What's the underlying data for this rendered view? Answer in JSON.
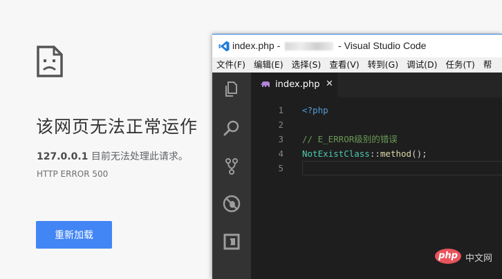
{
  "error_page": {
    "title": "该网页无法正常运作",
    "host": "127.0.0.1",
    "description": " 目前无法处理此请求。",
    "error_code": "HTTP ERROR 500",
    "reload_button": "重新加载"
  },
  "vscode": {
    "title_prefix": "index.php - ",
    "title_suffix": " - Visual Studio Code",
    "menu": [
      "文件(F)",
      "编辑(E)",
      "选择(S)",
      "查看(V)",
      "转到(G)",
      "调试(D)",
      "任务(T)",
      "帮"
    ],
    "activity_icons": [
      "explorer-icon",
      "search-icon",
      "source-control-icon",
      "debug-icon",
      "extensions-icon"
    ],
    "tab": {
      "label": "index.php",
      "close": "✕",
      "icon": "php-elephant-icon"
    },
    "lines": [
      {
        "num": "1",
        "tokens": [
          {
            "cls": "php-tag",
            "text": "<?php"
          }
        ]
      },
      {
        "num": "2",
        "tokens": []
      },
      {
        "num": "3",
        "tokens": [
          {
            "cls": "comment",
            "text": "// E_ERROR级别的错误"
          }
        ]
      },
      {
        "num": "4",
        "tokens": [
          {
            "cls": "cls",
            "text": "NotExistClass"
          },
          {
            "cls": "op",
            "text": "::"
          },
          {
            "cls": "fn",
            "text": "method"
          },
          {
            "cls": "op",
            "text": "();"
          }
        ]
      },
      {
        "num": "5",
        "tokens": []
      }
    ]
  },
  "watermark": {
    "logo": "php",
    "text": "中文网"
  },
  "colors": {
    "page_bg": "#f7f7f7",
    "button_blue": "#4285f4",
    "editor_bg": "#1e1e1e",
    "activity_bar": "#333333"
  }
}
